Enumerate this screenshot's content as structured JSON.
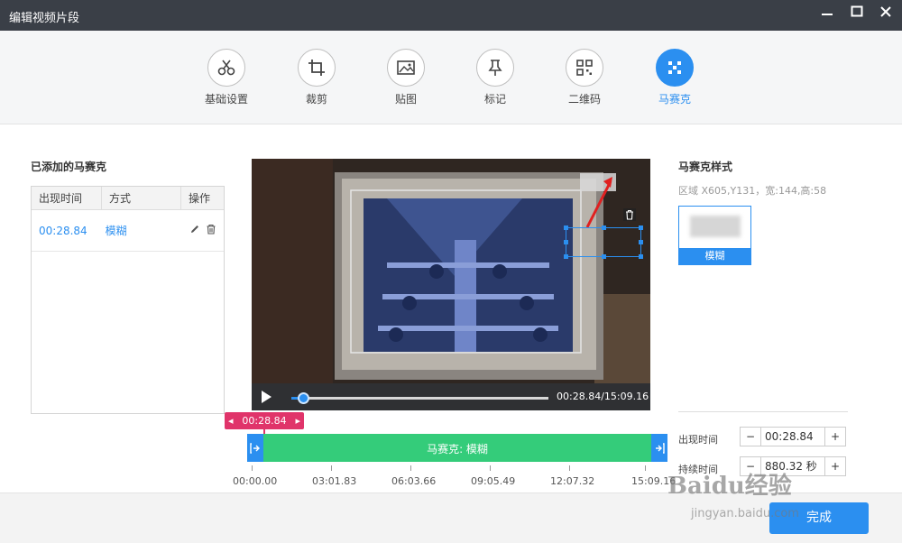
{
  "window": {
    "title": "编辑视频片段"
  },
  "toolbar": {
    "tools": [
      {
        "label": "基础设置",
        "icon": "scissors-icon"
      },
      {
        "label": "裁剪",
        "icon": "crop-icon"
      },
      {
        "label": "贴图",
        "icon": "image-icon"
      },
      {
        "label": "标记",
        "icon": "pin-icon"
      },
      {
        "label": "二维码",
        "icon": "qrcode-icon"
      },
      {
        "label": "马赛克",
        "icon": "mosaic-icon",
        "active": true
      }
    ]
  },
  "left_panel": {
    "title": "已添加的马赛克",
    "columns": [
      "出现时间",
      "方式",
      "操作"
    ],
    "rows": [
      {
        "time": "00:28.84",
        "mode": "模糊"
      }
    ]
  },
  "player": {
    "time_display": "00:28.84/15:09.16",
    "progress_fraction": 0.032
  },
  "timeline": {
    "marker_time": "00:28.84",
    "track_label": "马赛克: 模糊",
    "ticks": [
      "00:00.00",
      "03:01.83",
      "06:03.66",
      "09:05.49",
      "12:07.32",
      "15:09.16"
    ]
  },
  "style_panel": {
    "title": "马赛克样式",
    "region": "区域 X605,Y131，宽:144,高:58",
    "style_option": "模糊"
  },
  "settings": {
    "start_label": "出现时间",
    "start_value": "00:28.84",
    "duration_label": "持续时间",
    "duration_value": "880.32 秒"
  },
  "footer": {
    "done_label": "完成"
  },
  "watermark": {
    "text": "Baidu经验",
    "url": "jingyan.baidu.com"
  },
  "colors": {
    "accent": "#2b8ff0",
    "track": "#34cc7a",
    "marker": "#e0346a"
  }
}
